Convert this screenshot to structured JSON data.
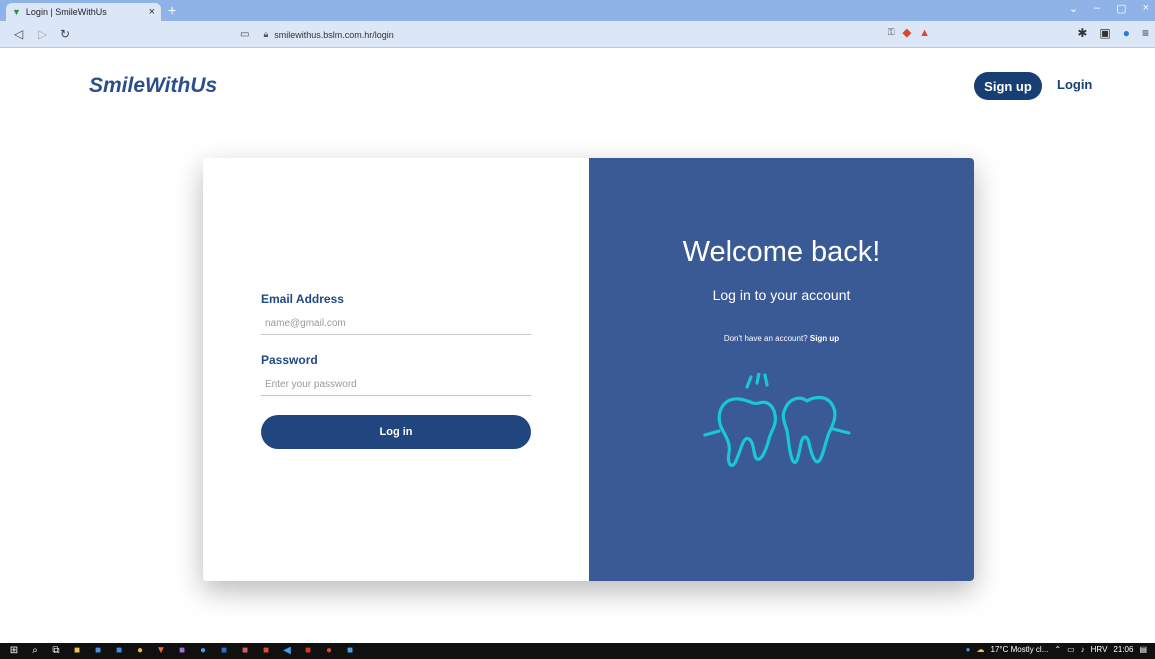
{
  "browser": {
    "tab_title": "Login | SmileWithUs",
    "tab_close": "×",
    "new_tab": "+",
    "url": "smilewithus.bslm.com.hr/login",
    "window_controls": [
      "⌄",
      "–",
      "▢",
      "×"
    ]
  },
  "header": {
    "logo": "SmileWithUs",
    "signup_label": "Sign up",
    "login_label": "Login"
  },
  "form": {
    "email_label": "Email Address",
    "email_placeholder": "name@gmail.com",
    "password_label": "Password",
    "password_placeholder": "Enter your password",
    "submit_label": "Log in"
  },
  "panel": {
    "welcome": "Welcome back!",
    "subtitle": "Log in to your account",
    "prompt_text": "Don't have an account?",
    "prompt_link": "Sign up"
  },
  "taskbar": {
    "weather": "17°C  Mostly cl...",
    "language": "HRV",
    "time": "21:06"
  },
  "colors": {
    "brand_dark": "#173f73",
    "panel_blue": "#3a5a96",
    "tooth_cyan": "#19c7d9"
  }
}
